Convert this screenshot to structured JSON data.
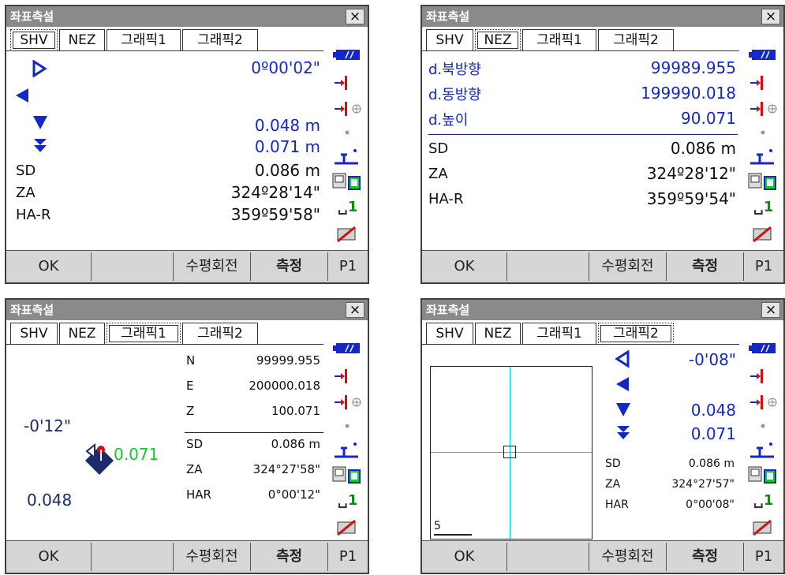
{
  "panels": [
    {
      "title": "좌표측설",
      "close": "×",
      "tabs": [
        "SHV",
        "NEZ",
        "그래픽1",
        "그래픽2"
      ],
      "active_tab": "SHV",
      "rows": [
        {
          "label": "",
          "value": "0º00'02\""
        },
        {
          "label": "",
          "value": ""
        },
        {
          "label": "",
          "value": "0.048 m"
        },
        {
          "label": "",
          "value": "0.071 m"
        },
        {
          "label": "SD",
          "value": "0.086 m"
        },
        {
          "label": "ZA",
          "value": "324º28'14\""
        },
        {
          "label": "HA-R",
          "value": "359º59'58\""
        }
      ],
      "buttons": [
        "OK",
        "",
        "수평회전",
        "측정",
        "P1"
      ]
    },
    {
      "title": "좌표측설",
      "close": "×",
      "tabs": [
        "SHV",
        "NEZ",
        "그래픽1",
        "그래픽2"
      ],
      "active_tab": "NEZ",
      "rows": [
        {
          "label": "d.북방향",
          "value": "99989.955"
        },
        {
          "label": "d.동방향",
          "value": "199990.018"
        },
        {
          "label": "d.높이",
          "value": "90.071"
        },
        {
          "label": "SD",
          "value": "0.086 m"
        },
        {
          "label": "ZA",
          "value": "324º28'12\""
        },
        {
          "label": "HA-R",
          "value": "359º59'54\""
        }
      ],
      "buttons": [
        "OK",
        "",
        "수평회전",
        "측정",
        "P1"
      ]
    },
    {
      "title": "좌표측설",
      "close": "×",
      "tabs": [
        "SHV",
        "NEZ",
        "그래픽1",
        "그래픽2"
      ],
      "active_tab": "그래픽1",
      "left_angle": "-0'12\"",
      "left_z": "0.071",
      "left_h": "0.048",
      "rows": [
        {
          "label": "N",
          "value": "99999.955"
        },
        {
          "label": "E",
          "value": "200000.018"
        },
        {
          "label": "Z",
          "value": "100.071"
        },
        {
          "label": "SD",
          "value": "0.086 m"
        },
        {
          "label": "ZA",
          "value": "324°27'58\""
        },
        {
          "label": "HAR",
          "value": "0°00'12\""
        }
      ],
      "buttons": [
        "OK",
        "",
        "수평회전",
        "측정",
        "P1"
      ]
    },
    {
      "title": "좌표측설",
      "close": "×",
      "tabs": [
        "SHV",
        "NEZ",
        "그래픽1",
        "그래픽2"
      ],
      "active_tab": "그래픽2",
      "scale": "5",
      "arrows": [
        {
          "value": "-0'08\""
        },
        {
          "value": ""
        },
        {
          "value": "0.048"
        },
        {
          "value": "0.071"
        }
      ],
      "rows": [
        {
          "label": "SD",
          "value": "0.086 m"
        },
        {
          "label": "ZA",
          "value": "324°27'57\""
        },
        {
          "label": "HAR",
          "value": "0°00'08\""
        }
      ],
      "buttons": [
        "OK",
        "",
        "수평회전",
        "측정",
        "P1"
      ]
    }
  ],
  "icons": [
    "battery-icon",
    "target-icon",
    "target-crosshair-icon",
    "dot-icon",
    "prism-icon",
    "instrument-icon",
    "prism-const-icon",
    "edit-icon"
  ],
  "icon_label_prism_const": "1",
  "colors": {
    "blue": "#1428c8",
    "navy": "#1a2a6c",
    "green": "#18c828",
    "red": "#d01010",
    "cyan": "#00cfd8"
  }
}
